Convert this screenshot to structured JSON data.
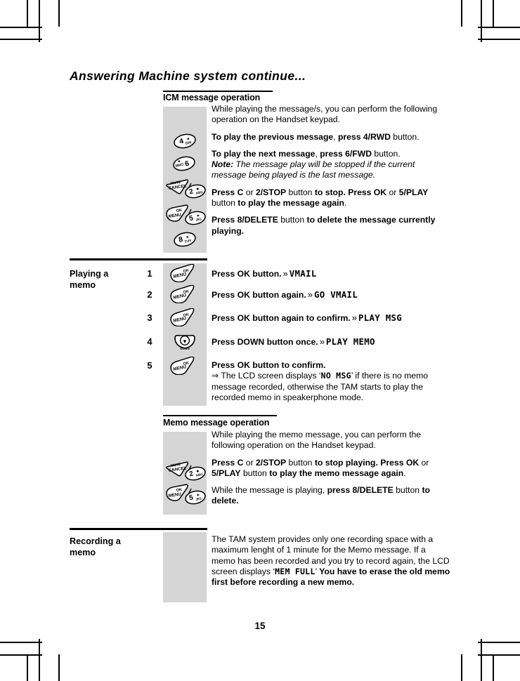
{
  "document": {
    "title": "Answering Machine system continue...",
    "page_number": "15"
  },
  "sections": [
    {
      "id": "icm",
      "heading": "ICM message operation",
      "icons": [
        "key-4-ghi",
        "key-6-mno",
        "key-mute-cancel",
        "key-2-abc",
        "key-ok-menu",
        "key-5-jkl",
        "key-8-tuv"
      ],
      "paragraphs": [
        "While playing the message/s, you can perform the following operation on the Handset keypad.",
        "To play the previous message, press 4/RWD button.",
        "To play the next message, press 6/FWD button. Note: The message play will be stopped if the current message being played is the last message.",
        "Press C or 2/STOP button to stop. Press OK or 5/PLAY button to play the message again.",
        "Press 8/DELETE button to delete the message currently playing."
      ]
    },
    {
      "id": "playing-a-memo",
      "label": "Playing a memo",
      "steps": [
        {
          "number": "1",
          "icon": "key-ok-menu",
          "instruction": "Press OK button.",
          "separator": "»",
          "lcd": "VMAIL"
        },
        {
          "number": "2",
          "icon": "key-ok-menu",
          "instruction": "Press OK button again.",
          "separator": "»",
          "lcd": "GO VMAIL"
        },
        {
          "number": "3",
          "icon": "key-ok-menu",
          "instruction": "Press OK button again to confirm.",
          "separator": "»",
          "lcd": "PLAY MSG"
        },
        {
          "number": "4",
          "icon": "key-down-arrow",
          "instruction": "Press DOWN button once.",
          "separator": "»",
          "lcd": "PLAY MEMO"
        },
        {
          "number": "5",
          "icon": "key-ok-menu",
          "instruction": "Press OK button to confirm.",
          "note_bullet": "⇒",
          "note_pre": "The LCD screen displays ‘",
          "note_lcd": "NO MSG",
          "note_post": "’ if there is no memo message recorded, otherwise the TAM starts to play the recorded memo in speakerphone mode."
        }
      ]
    },
    {
      "id": "memo-message-operation",
      "heading": "Memo message operation",
      "icons": [
        "key-mute-cancel",
        "key-2-abc",
        "key-ok-menu",
        "key-5-jkl"
      ],
      "paragraphs": [
        "While playing the memo message, you can perform the following operation on the Handset keypad.",
        "Press C or 2/STOP button to stop playing. Press OK or 5/PLAY button to play the memo message again.",
        "While the message is playing, press 8/DELETE button to delete."
      ]
    },
    {
      "id": "recording-a-memo",
      "label": "Recording a memo",
      "paragraph_pre": "The TAM system provides only one recording space with a maximum lenght of 1 minute for the Memo message. If a memo has been recorded and you try to record again, the LCD screen displays ‘",
      "paragraph_lcd": "MEM FULL",
      "paragraph_post": "’ ",
      "paragraph_bold_tail": "You have to erase the old memo first before recording a new memo."
    }
  ],
  "keys": {
    "key-4-ghi": {
      "digit": "4",
      "letters": "GHI",
      "symbol": "◄"
    },
    "key-6-mno": {
      "digit": "6",
      "letters": "MNO",
      "symbol": "►"
    },
    "key-2-abc": {
      "digit": "2",
      "letters": "ABC",
      "symbol": "■"
    },
    "key-5-jkl": {
      "digit": "5",
      "letters": "JKL",
      "symbol": "►"
    },
    "key-8-tuv": {
      "digit": "8",
      "letters": "TUV",
      "symbol": "✕"
    },
    "key-mute-cancel": {
      "top": "MUTE",
      "bottom": "CANCEL"
    },
    "key-ok-menu": {
      "top": "OK",
      "bottom": "MENU"
    },
    "key-down-arrow": {
      "symbol": "▼"
    }
  },
  "colors": {
    "icon_column_bg": "#d5d5d5",
    "text": "#000000",
    "page_bg": "#ffffff"
  }
}
